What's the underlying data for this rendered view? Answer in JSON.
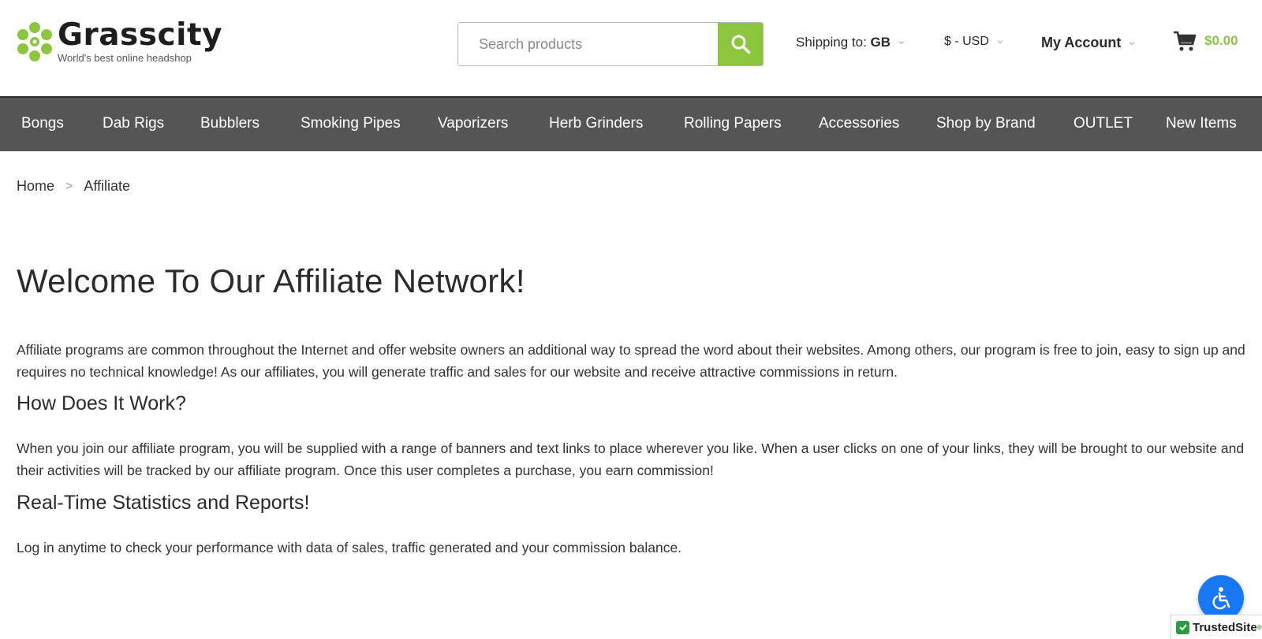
{
  "brand": {
    "name": "Grasscity",
    "tagline": "World's best online headshop",
    "accent": "#8cc63f"
  },
  "search": {
    "placeholder": "Search products",
    "value": ""
  },
  "header": {
    "shipping_label": "Shipping to:",
    "shipping_country": "GB",
    "currency": "$ - USD",
    "account": "My Account",
    "cart_total": "$0.00"
  },
  "nav": {
    "items": [
      {
        "label": "Bongs"
      },
      {
        "label": "Dab Rigs"
      },
      {
        "label": "Bubblers"
      },
      {
        "label": "Smoking Pipes"
      },
      {
        "label": "Vaporizers"
      },
      {
        "label": "Herb Grinders"
      },
      {
        "label": "Rolling Papers"
      },
      {
        "label": "Accessories"
      },
      {
        "label": "Shop by Brand"
      },
      {
        "label": "OUTLET"
      },
      {
        "label": "New Items"
      }
    ]
  },
  "breadcrumb": {
    "home": "Home",
    "separator": ">",
    "current": "Affiliate"
  },
  "main": {
    "title": "Welcome To Our Affiliate Network!",
    "intro": "Affiliate programs are common throughout the Internet and offer website owners an additional way to spread the word about their websites. Among others, our program is free to join, easy to sign up and requires no technical knowledge! As our affiliates, you will generate traffic and sales for our website and receive attractive commissions in return.",
    "section1_title": "How Does It Work?",
    "section1_text": "When you join our affiliate program, you will be supplied with a range of banners and text links to place wherever you like. When a user clicks on one of your links, they will be brought to our website and their activities will be tracked by our affiliate program. Once this user completes a purchase, you earn commission!",
    "section2_title": "Real-Time Statistics and Reports!",
    "section2_text": "Log in anytime to check your performance with data of sales, traffic generated and your commission balance."
  },
  "widgets": {
    "trusted_label": "TrustedSite",
    "trusted_mark": "®"
  }
}
